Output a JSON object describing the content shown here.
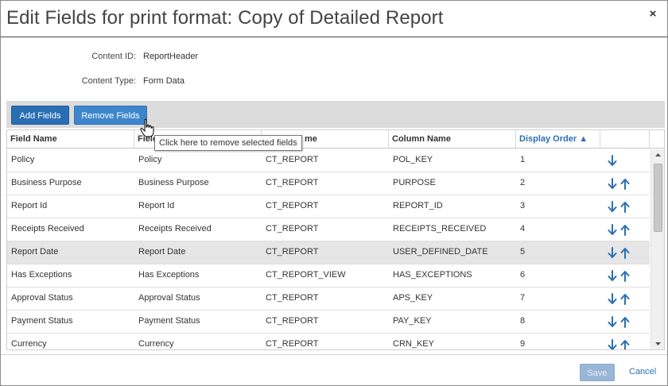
{
  "dialog": {
    "title": "Edit Fields for print format: Copy of Detailed Report",
    "close_glyph": "×"
  },
  "meta": {
    "content_id_label": "Content ID:",
    "content_id_value": "ReportHeader",
    "content_type_label": "Content Type:",
    "content_type_value": "Form Data"
  },
  "toolbar": {
    "add_label": "Add Fields",
    "remove_label": "Remove Fields"
  },
  "tooltip": "Click here to remove selected fields",
  "table": {
    "headers": [
      "Field Name",
      "Field",
      "me",
      "Column Name",
      "Display Order ▲"
    ],
    "sorted_column": "Display Order",
    "rows": [
      {
        "field_name": "Policy",
        "label": "Policy",
        "table": "CT_REPORT",
        "column": "POL_KEY",
        "order": "1",
        "up": false,
        "selected": false
      },
      {
        "field_name": "Business Purpose",
        "label": "Business Purpose",
        "table": "CT_REPORT",
        "column": "PURPOSE",
        "order": "2",
        "up": true,
        "selected": false
      },
      {
        "field_name": "Report Id",
        "label": "Report Id",
        "table": "CT_REPORT",
        "column": "REPORT_ID",
        "order": "3",
        "up": true,
        "selected": false
      },
      {
        "field_name": "Receipts Received",
        "label": "Receipts Received",
        "table": "CT_REPORT",
        "column": "RECEIPTS_RECEIVED",
        "order": "4",
        "up": true,
        "selected": false
      },
      {
        "field_name": "Report Date",
        "label": "Report Date",
        "table": "CT_REPORT",
        "column": "USER_DEFINED_DATE",
        "order": "5",
        "up": true,
        "selected": true
      },
      {
        "field_name": "Has Exceptions",
        "label": "Has Exceptions",
        "table": "CT_REPORT_VIEW",
        "column": "HAS_EXCEPTIONS",
        "order": "6",
        "up": true,
        "selected": false
      },
      {
        "field_name": "Approval Status",
        "label": "Approval Status",
        "table": "CT_REPORT",
        "column": "APS_KEY",
        "order": "7",
        "up": true,
        "selected": false
      },
      {
        "field_name": "Payment Status",
        "label": "Payment Status",
        "table": "CT_REPORT",
        "column": "PAY_KEY",
        "order": "8",
        "up": true,
        "selected": false
      },
      {
        "field_name": "Currency",
        "label": "Currency",
        "table": "CT_REPORT",
        "column": "CRN_KEY",
        "order": "9",
        "up": true,
        "selected": false
      }
    ]
  },
  "footer": {
    "save_label": "Save",
    "cancel_label": "Cancel"
  },
  "icons": {
    "move_down": "arrow-down-icon",
    "move_up": "arrow-up-icon",
    "cursor": "hand-pointer-icon"
  },
  "colors": {
    "accent": "#2a6fb4",
    "selected_row": "#e6e6e6",
    "toolbar": "#dcdcdc",
    "save_disabled": "#9ab6d6"
  }
}
